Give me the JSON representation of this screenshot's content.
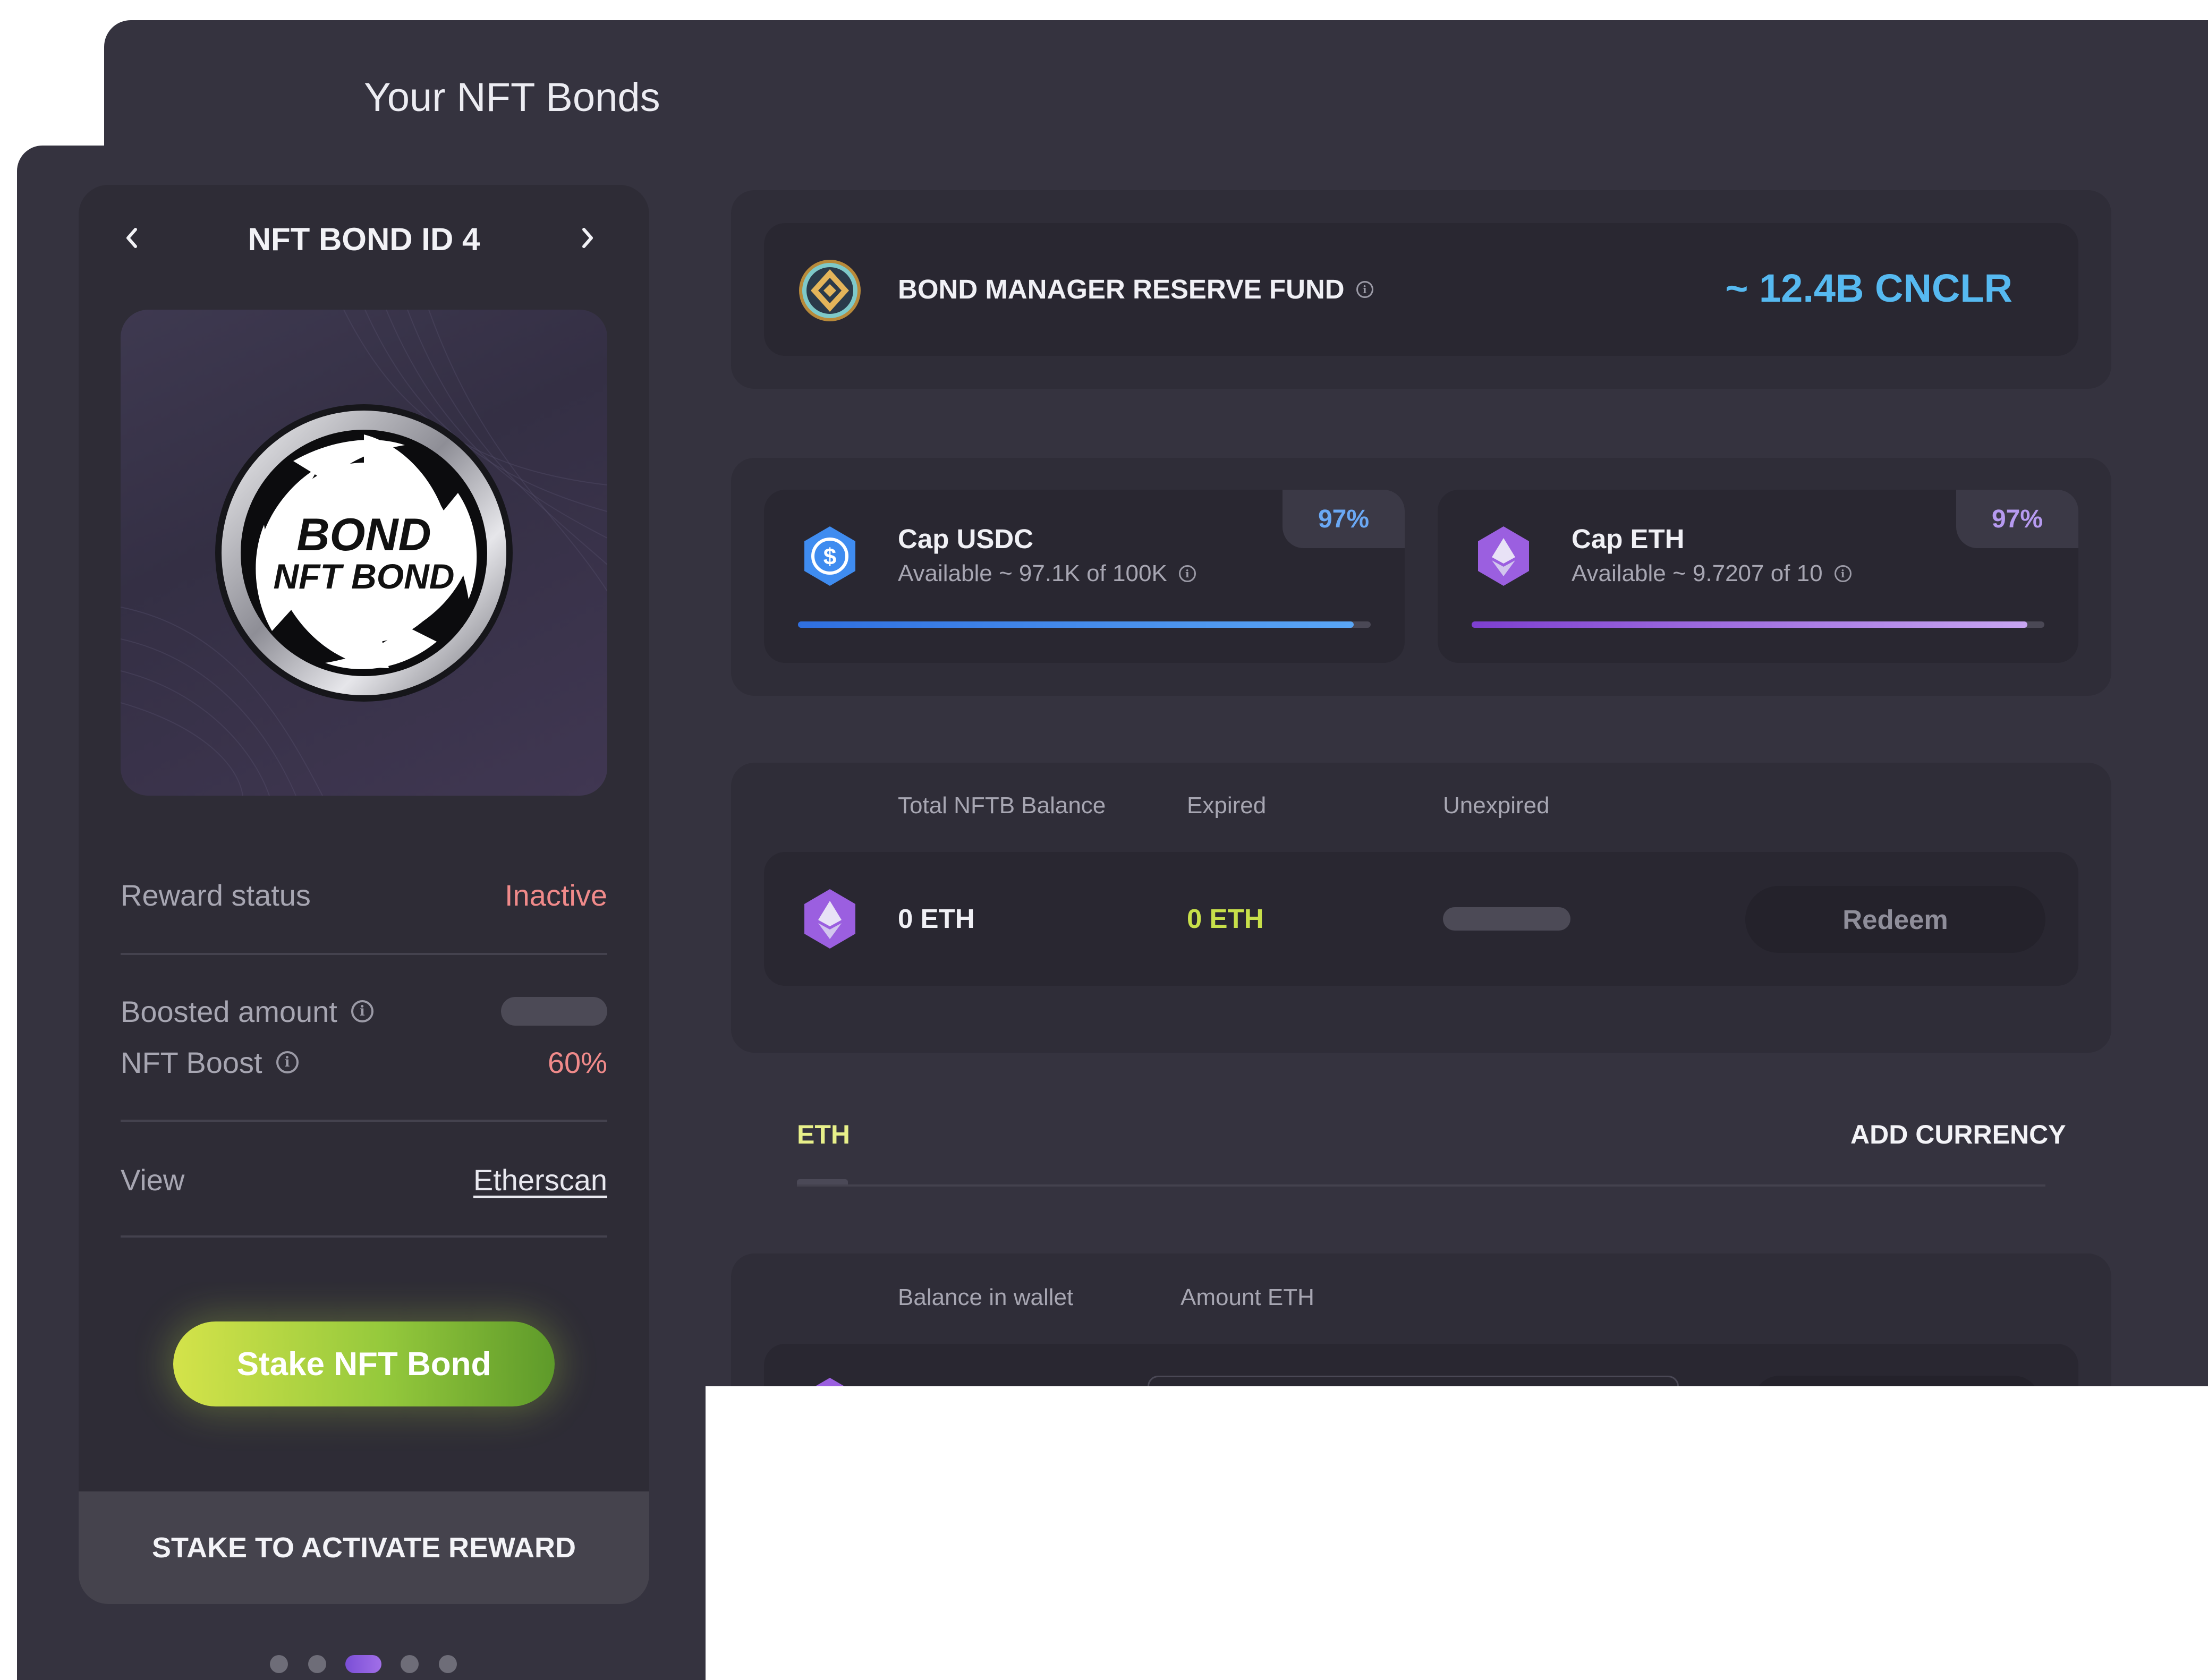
{
  "page": {
    "title": "Your NFT Bonds"
  },
  "nft_card": {
    "title": "NFT BOND ID 4",
    "prev_icon": "chevron-left-icon",
    "next_icon": "chevron-right-icon",
    "image_text": [
      "BOND",
      "NFT BOND"
    ],
    "reward_status_label": "Reward status",
    "reward_status_value": "Inactive",
    "boosted_amount_label": "Boosted amount",
    "nft_boost_label": "NFT Boost",
    "nft_boost_value": "60%",
    "view_label": "View",
    "view_link": "Etherscan",
    "stake_button": "Stake NFT Bond",
    "activate_label": "STAKE TO ACTIVATE REWARD",
    "pagination": {
      "count": 5,
      "active_index": 2
    }
  },
  "reserve_fund": {
    "label": "BOND MANAGER RESERVE FUND",
    "value": "~ 12.4B CNCLR"
  },
  "caps": [
    {
      "title": "Cap USDC",
      "available": "Available ~ 97.1K of 100K",
      "percent": "97%",
      "fill": 0.97,
      "icon": "usdc-icon",
      "accent": "#3f8cf0"
    },
    {
      "title": "Cap ETH",
      "available": "Available ~ 9.7207 of 10",
      "percent": "97%",
      "fill": 0.97,
      "icon": "eth-icon",
      "accent": "#9b5fe0"
    }
  ],
  "balance": {
    "headers": [
      "Total NFTB Balance",
      "Expired",
      "Unexpired"
    ],
    "total": "0 ETH",
    "expired": "0 ETH",
    "redeem_button": "Redeem"
  },
  "tabs": {
    "active": "ETH",
    "add_currency": "ADD CURRENCY"
  },
  "deposit": {
    "headers": [
      "Balance in wallet",
      "Amount ETH"
    ]
  },
  "colors": {
    "accent_blue": "#56b9f0",
    "accent_green": "#c8e04a",
    "status_red": "#f08a8a",
    "panel_bg": "#2f2d38"
  }
}
